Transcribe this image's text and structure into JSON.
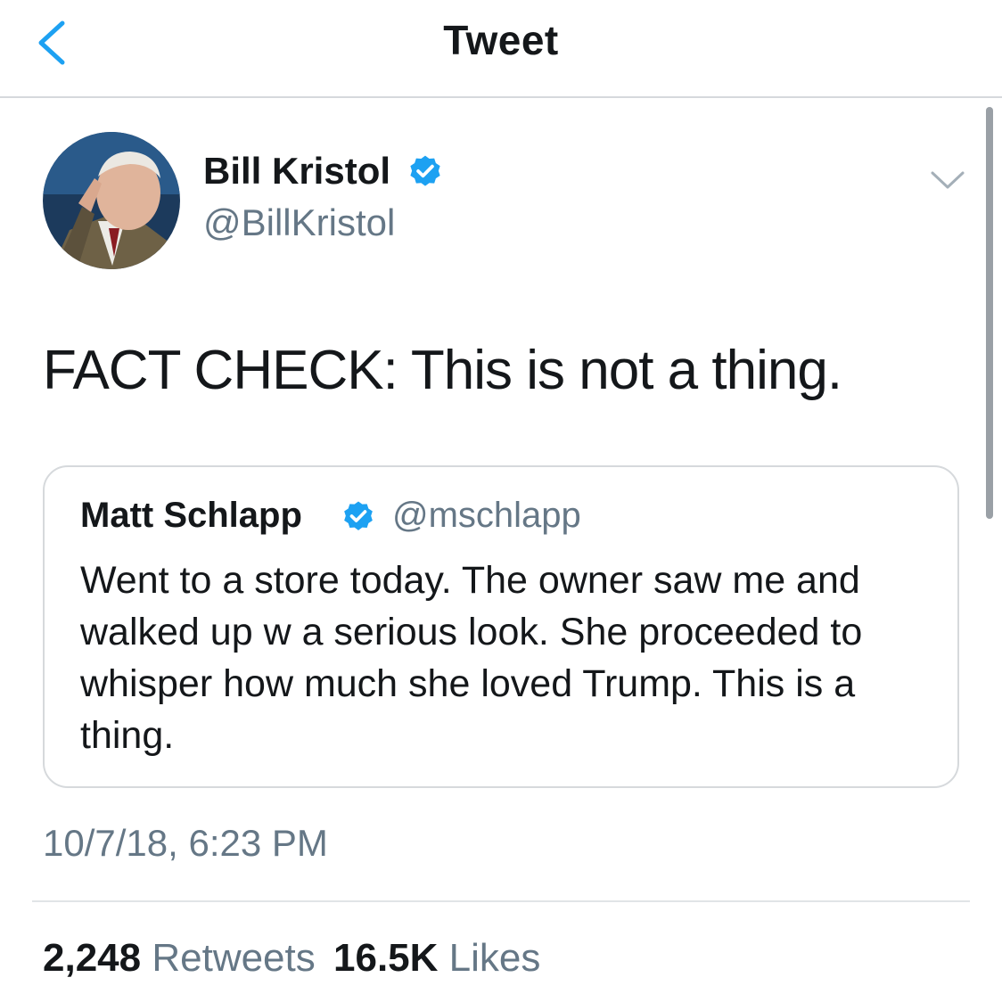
{
  "header": {
    "title": "Tweet",
    "back_icon": "chevron-left-icon"
  },
  "tweet": {
    "author": {
      "name": "Bill Kristol",
      "handle": "@BillKristol",
      "verified": true
    },
    "text": "FACT CHECK: This is not a thing.",
    "quoted_tweet": {
      "author_name": "Matt Schlapp",
      "author_handle": "@mschlapp",
      "verified": true,
      "text": "Went to a store today. The owner saw me and walked up w a serious look. She proceeded to whisper how much she loved Trump. This is a thing."
    },
    "timestamp": "10/7/18, 6:23 PM",
    "stats": {
      "retweets_count": "2,248",
      "retweets_label": "Retweets",
      "likes_count": "16.5K",
      "likes_label": "Likes"
    }
  },
  "colors": {
    "accent": "#1da1f2",
    "text_primary": "#14171a",
    "text_secondary": "#657786",
    "border": "#d6d9dc"
  }
}
